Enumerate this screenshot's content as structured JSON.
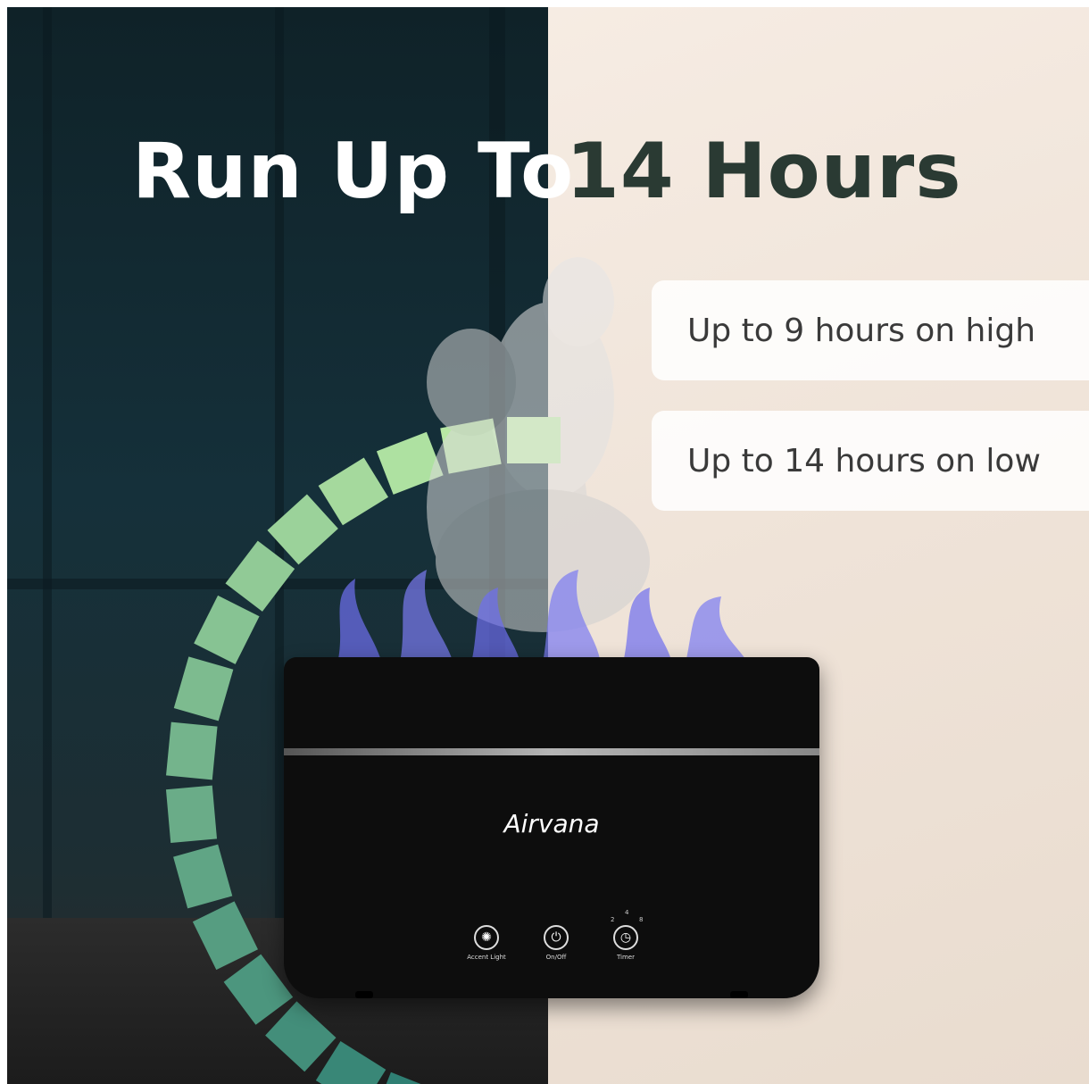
{
  "headline": {
    "part1": "Run Up To",
    "part2": "14 Hours"
  },
  "features": [
    "Up to 9 hours on high",
    "Up to 14 hours on low"
  ],
  "device": {
    "brand": "Airvana",
    "controls": [
      {
        "label": "Accent Light",
        "icon": "bulb-icon"
      },
      {
        "label": "On/Off",
        "icon": "power-icon"
      },
      {
        "label": "Timer",
        "icon": "clock-icon"
      }
    ],
    "timer_levels": [
      "2",
      "4",
      "8"
    ]
  },
  "colors": {
    "arc_start": "#2f7f73",
    "arc_end": "#c2f0a8",
    "headline_dark": "#2a3a33",
    "flame": "#6f6ff0"
  }
}
